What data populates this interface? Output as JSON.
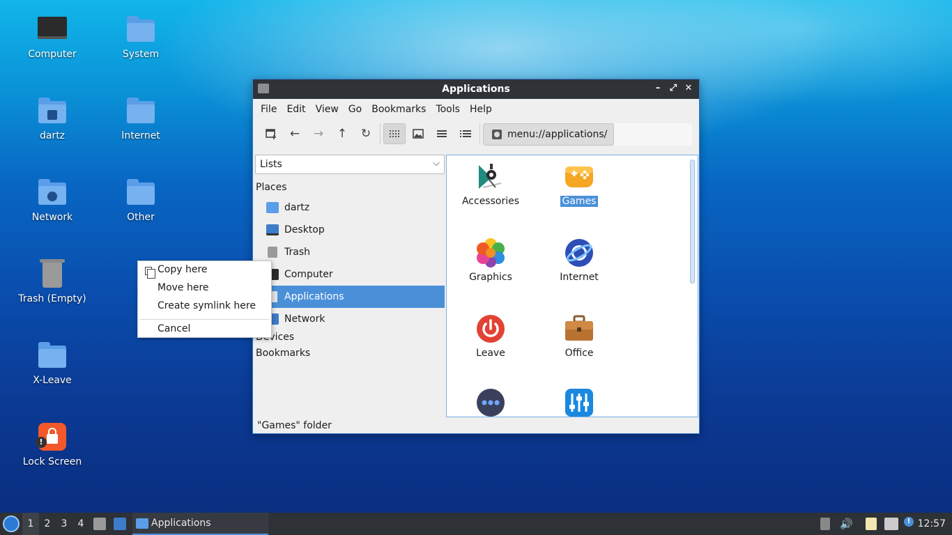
{
  "desktop": {
    "icons": [
      {
        "label": "Computer",
        "icon": "computer-icon"
      },
      {
        "label": "System",
        "icon": "folder-icon"
      },
      {
        "label": "dartz",
        "icon": "home-folder-icon"
      },
      {
        "label": "Internet",
        "icon": "folder-icon"
      },
      {
        "label": "Network",
        "icon": "network-folder-icon"
      },
      {
        "label": "Other",
        "icon": "folder-icon"
      },
      {
        "label": "Trash (Empty)",
        "icon": "trash-icon"
      },
      {
        "label": "X-Leave",
        "icon": "folder-icon"
      },
      {
        "label": "Lock Screen",
        "icon": "lock-icon"
      }
    ]
  },
  "context_menu": {
    "items": [
      "Copy here",
      "Move here",
      "Create symlink here",
      "Cancel"
    ]
  },
  "window": {
    "title": "Applications",
    "controls": {
      "minimize": "–",
      "maximize": "⤢",
      "close": "✕"
    },
    "menu": [
      "File",
      "Edit",
      "View",
      "Go",
      "Bookmarks",
      "Tools",
      "Help"
    ],
    "location": "menu://applications/",
    "side_pane_mode": "Lists",
    "places_header": "Places",
    "places": [
      "dartz",
      "Desktop",
      "Trash",
      "Computer",
      "Applications",
      "Network"
    ],
    "selected_place": "Applications",
    "devices_header": "Devices",
    "bookmarks_header": "Bookmarks",
    "apps": [
      "Accessories",
      "Games",
      "Graphics",
      "Internet",
      "Leave",
      "Office"
    ],
    "selected_app": "Games",
    "status": "\"Games\" folder"
  },
  "taskbar": {
    "workspaces": [
      "1",
      "2",
      "3",
      "4"
    ],
    "current_workspace": "1",
    "task_label": "Applications",
    "clock": "12:57"
  },
  "colors": {
    "accent": "#4a90d9",
    "titlebar": "#2f3338",
    "taskbar": "#2e3136"
  }
}
